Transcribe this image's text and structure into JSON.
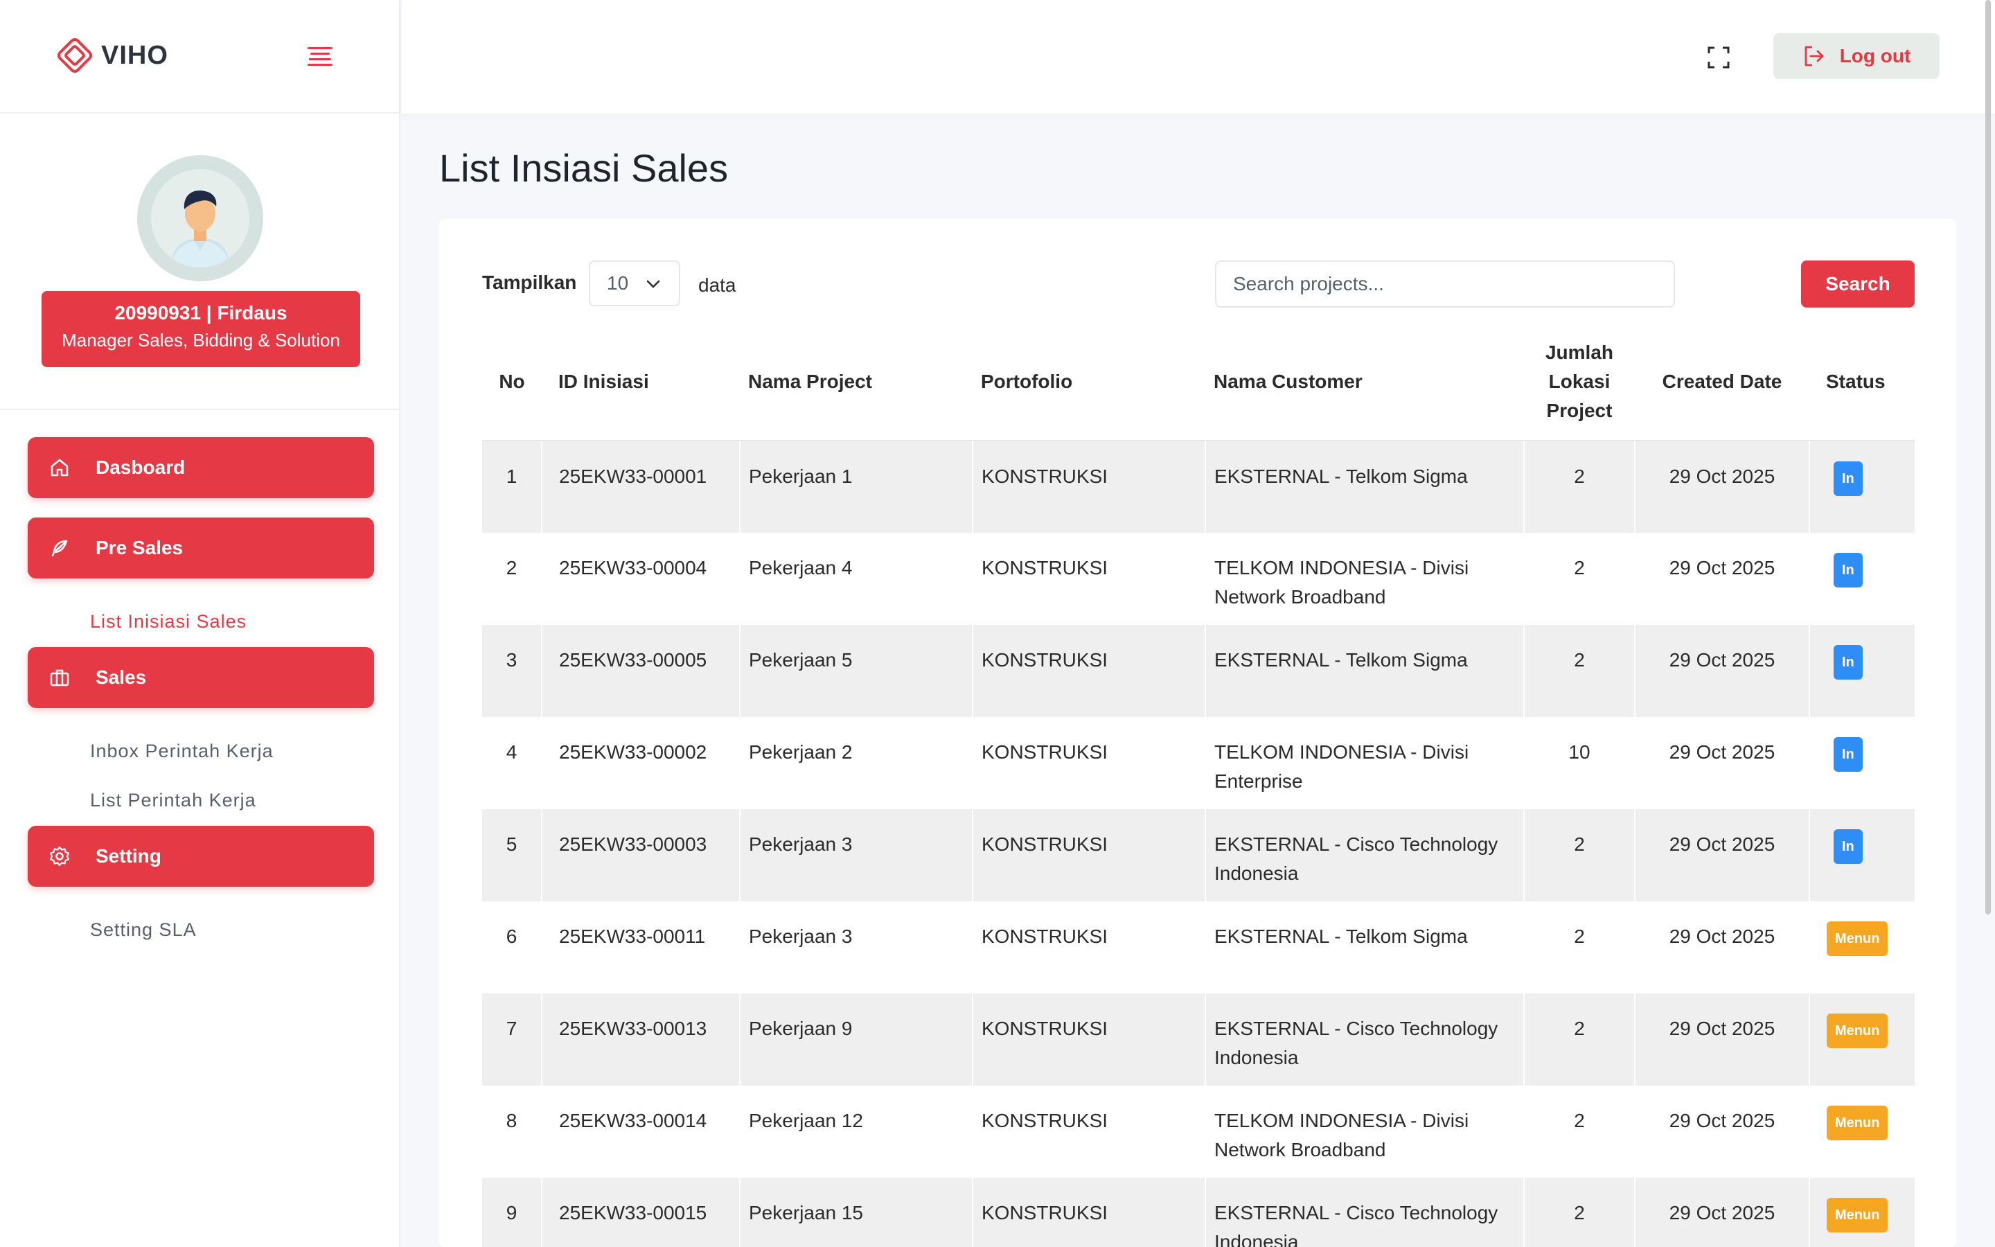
{
  "app": {
    "name": "VIHO"
  },
  "header": {
    "logout_label": "Log out"
  },
  "profile": {
    "id_name": "20990931 | Firdaus",
    "role": "Manager Sales, Bidding & Solution"
  },
  "nav": {
    "dashboard": "Dasboard",
    "pre_sales": "Pre Sales",
    "list_inisiasi": "List Inisiasi Sales",
    "sales": "Sales",
    "inbox_perintah": "Inbox Perintah Kerja",
    "list_perintah": "List Perintah Kerja",
    "setting": "Setting",
    "setting_sla": "Setting SLA"
  },
  "page": {
    "title": "List Insiasi Sales"
  },
  "controls": {
    "show_label": "Tampilkan",
    "show_value": "10",
    "data_label": "data",
    "search_placeholder": "Search projects...",
    "search_button": "Search"
  },
  "table": {
    "headers": {
      "no": "No",
      "id": "ID Inisiasi",
      "name": "Nama Project",
      "portfolio": "Portofolio",
      "customer": "Nama Customer",
      "jumlah": "Jumlah Lokasi Project",
      "date": "Created Date",
      "status": "Status"
    },
    "rows": [
      {
        "no": "1",
        "id": "25EKW33-00001",
        "name": "Pekerjaan 1",
        "portfolio": "KONSTRUKSI",
        "customer": "EKSTERNAL - Telkom Sigma",
        "jumlah": "2",
        "date": "29 Oct 2025",
        "status": "In"
      },
      {
        "no": "2",
        "id": "25EKW33-00004",
        "name": "Pekerjaan 4",
        "portfolio": "KONSTRUKSI",
        "customer": "TELKOM INDONESIA - Divisi Network Broadband",
        "jumlah": "2",
        "date": "29 Oct 2025",
        "status": "In"
      },
      {
        "no": "3",
        "id": "25EKW33-00005",
        "name": "Pekerjaan 5",
        "portfolio": "KONSTRUKSI",
        "customer": "EKSTERNAL - Telkom Sigma",
        "jumlah": "2",
        "date": "29 Oct 2025",
        "status": "In"
      },
      {
        "no": "4",
        "id": "25EKW33-00002",
        "name": "Pekerjaan 2",
        "portfolio": "KONSTRUKSI",
        "customer": "TELKOM INDONESIA - Divisi Enterprise",
        "jumlah": "10",
        "date": "29 Oct 2025",
        "status": "In"
      },
      {
        "no": "5",
        "id": "25EKW33-00003",
        "name": "Pekerjaan 3",
        "portfolio": "KONSTRUKSI",
        "customer": "EKSTERNAL - Cisco Technology Indonesia",
        "jumlah": "2",
        "date": "29 Oct 2025",
        "status": "In"
      },
      {
        "no": "6",
        "id": "25EKW33-00011",
        "name": "Pekerjaan 3",
        "portfolio": "KONSTRUKSI",
        "customer": "EKSTERNAL - Telkom Sigma",
        "jumlah": "2",
        "date": "29 Oct 2025",
        "status": "Menun"
      },
      {
        "no": "7",
        "id": "25EKW33-00013",
        "name": "Pekerjaan 9",
        "portfolio": "KONSTRUKSI",
        "customer": "EKSTERNAL - Cisco Technology Indonesia",
        "jumlah": "2",
        "date": "29 Oct 2025",
        "status": "Menun"
      },
      {
        "no": "8",
        "id": "25EKW33-00014",
        "name": "Pekerjaan 12",
        "portfolio": "KONSTRUKSI",
        "customer": "TELKOM INDONESIA - Divisi Network Broadband",
        "jumlah": "2",
        "date": "29 Oct 2025",
        "status": "Menun"
      },
      {
        "no": "9",
        "id": "25EKW33-00015",
        "name": "Pekerjaan 15",
        "portfolio": "KONSTRUKSI",
        "customer": "EKSTERNAL - Cisco Technology Indonesia",
        "jumlah": "2",
        "date": "29 Oct 2025",
        "status": "Menun"
      }
    ]
  },
  "colors": {
    "primary": "#e53945",
    "badge_in": "#2f8ef5",
    "badge_pending": "#f5a623"
  }
}
